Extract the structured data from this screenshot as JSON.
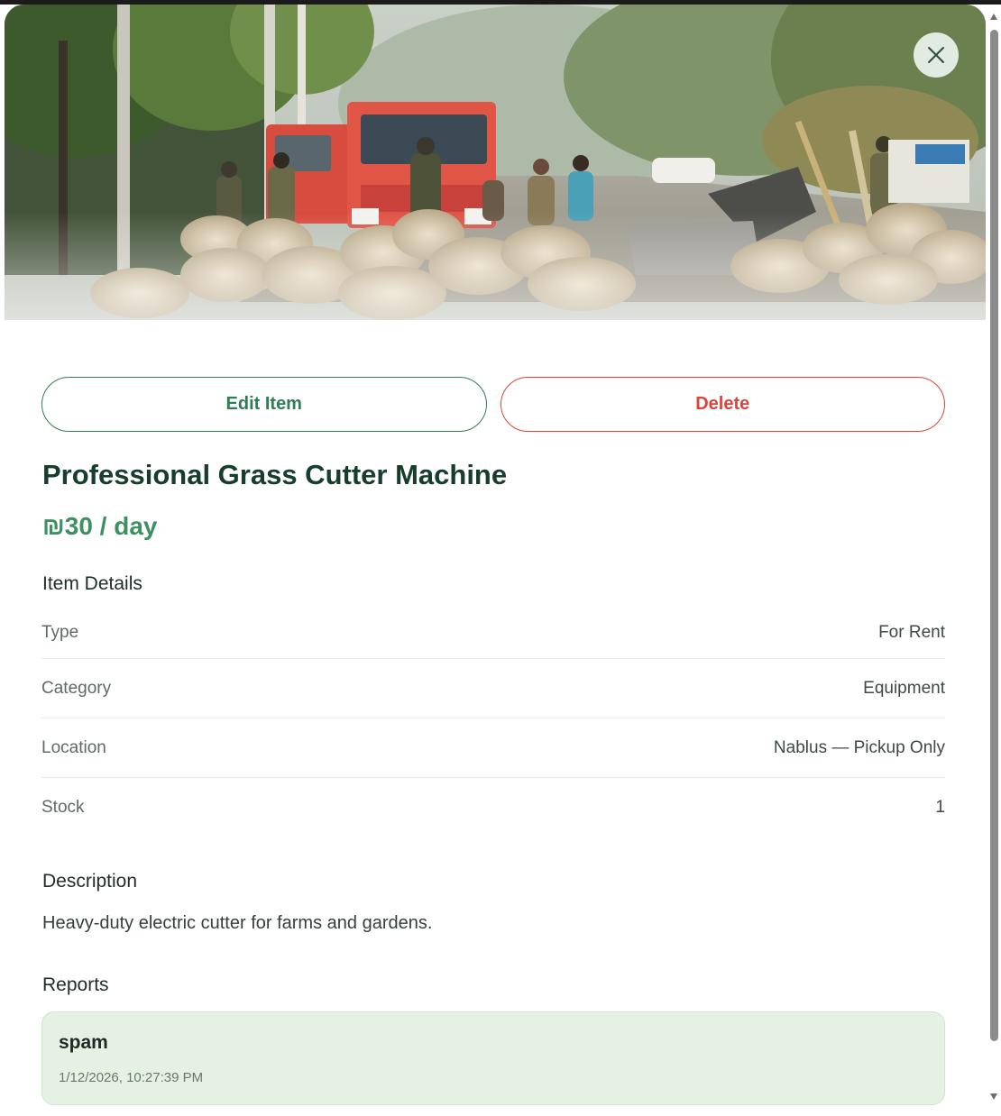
{
  "hero": {
    "close_icon": "close-icon"
  },
  "actions": {
    "edit_label": "Edit Item",
    "delete_label": "Delete"
  },
  "item": {
    "title": "Professional Grass Cutter Machine",
    "price": "₪30 / day"
  },
  "details": {
    "heading": "Item Details",
    "rows": [
      {
        "label": "Type",
        "value": "For Rent"
      },
      {
        "label": "Category",
        "value": "Equipment"
      },
      {
        "label": "Location",
        "value": "Nablus — Pickup Only"
      },
      {
        "label": "Stock",
        "value": "1"
      }
    ]
  },
  "description": {
    "heading": "Description",
    "text": "Heavy-duty electric cutter for farms and gardens."
  },
  "reports": {
    "heading": "Reports",
    "items": [
      {
        "reason": "spam",
        "timestamp": "1/12/2026, 10:27:39 PM"
      }
    ]
  },
  "colors": {
    "accent_green": "#2f7d52",
    "price_green": "#3d9161",
    "danger_red": "#d9443c",
    "title_dark_green": "#173d2c",
    "report_bg": "#e4f1e3"
  }
}
